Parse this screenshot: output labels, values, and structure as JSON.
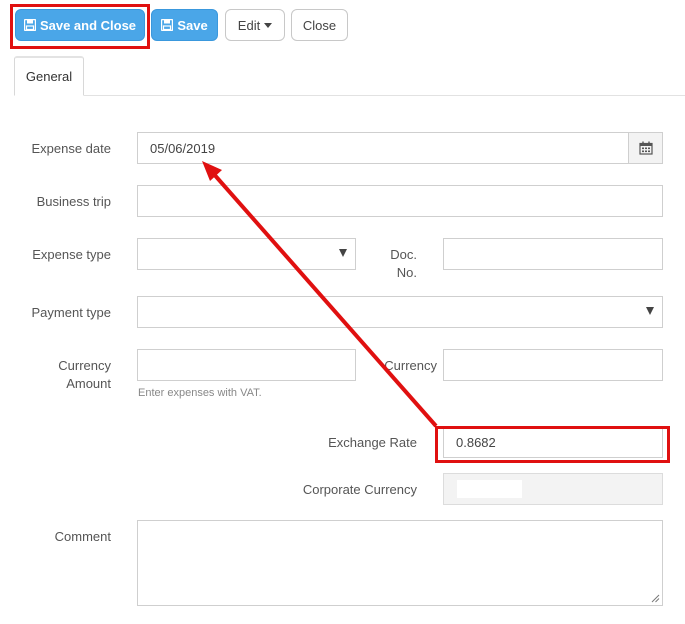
{
  "toolbar": {
    "save_close_label": "Save and Close",
    "save_label": "Save",
    "edit_label": "Edit",
    "close_label": "Close"
  },
  "tabs": [
    {
      "label": "General"
    }
  ],
  "form": {
    "expense_date": {
      "label": "Expense date",
      "value": "05/06/2019"
    },
    "business_trip": {
      "label": "Business trip",
      "value": ""
    },
    "expense_type": {
      "label": "Expense type",
      "value": ""
    },
    "doc_no": {
      "label_line1": "Doc.",
      "label_line2": "No.",
      "value": ""
    },
    "payment_type": {
      "label": "Payment type",
      "value": ""
    },
    "currency_amount": {
      "label_line1": "Currency",
      "label_line2": "Amount",
      "value": "",
      "help": "Enter expenses with VAT."
    },
    "currency": {
      "label": "Currency",
      "value": ""
    },
    "exchange_rate": {
      "label": "Exchange Rate",
      "value": "0.8682"
    },
    "corporate_currency": {
      "label": "Corporate Currency",
      "value": ""
    },
    "comment": {
      "label": "Comment",
      "value": ""
    }
  },
  "colors": {
    "primary": "#4aa6e8",
    "annotation": "#e01010"
  }
}
